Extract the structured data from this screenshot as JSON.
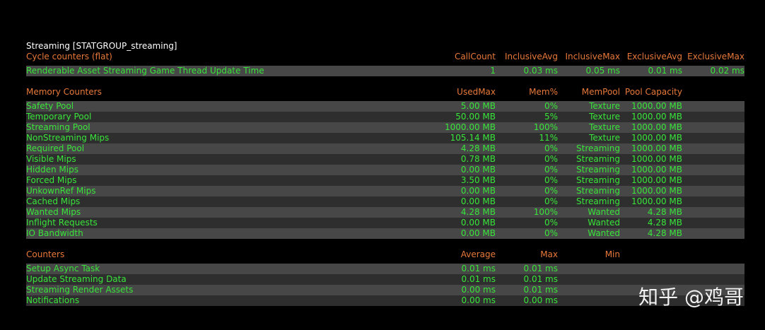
{
  "title": "Streaming [STATGROUP_streaming]",
  "cycle": {
    "header": [
      "Cycle counters (flat)",
      "CallCount",
      "InclusiveAvg",
      "InclusiveMax",
      "ExclusiveAvg",
      "ExclusiveMax"
    ],
    "rows": [
      [
        "Renderable Asset Streaming Game Thread Update Time",
        "1",
        "0.03 ms",
        "0.05 ms",
        "0.01 ms",
        "0.02 ms"
      ]
    ]
  },
  "memory": {
    "header": [
      "Memory Counters",
      "UsedMax",
      "Mem%",
      "MemPool",
      "Pool Capacity"
    ],
    "rows": [
      [
        "Safety Pool",
        "5.00 MB",
        "0%",
        "Texture",
        "1000.00 MB"
      ],
      [
        "Temporary Pool",
        "50.00 MB",
        "5%",
        "Texture",
        "1000.00 MB"
      ],
      [
        "Streaming Pool",
        "1000.00 MB",
        "100%",
        "Texture",
        "1000.00 MB"
      ],
      [
        "NonStreaming Mips",
        "105.14 MB",
        "11%",
        "Texture",
        "1000.00 MB"
      ],
      [
        "Required Pool",
        "4.28 MB",
        "0%",
        "Streaming",
        "1000.00 MB"
      ],
      [
        "Visible Mips",
        "0.78 MB",
        "0%",
        "Streaming",
        "1000.00 MB"
      ],
      [
        "Hidden Mips",
        "0.00 MB",
        "0%",
        "Streaming",
        "1000.00 MB"
      ],
      [
        "Forced Mips",
        "3.50 MB",
        "0%",
        "Streaming",
        "1000.00 MB"
      ],
      [
        "UnkownRef Mips",
        "0.00 MB",
        "0%",
        "Streaming",
        "1000.00 MB"
      ],
      [
        "Cached Mips",
        "0.00 MB",
        "0%",
        "Streaming",
        "1000.00 MB"
      ],
      [
        "Wanted Mips",
        "4.28 MB",
        "100%",
        "Wanted",
        "4.28 MB"
      ],
      [
        "Inflight Requests",
        "0.00 MB",
        "0%",
        "Wanted",
        "4.28 MB"
      ],
      [
        "IO Bandwidth",
        "0.00 MB",
        "0%",
        "Wanted",
        "4.28 MB"
      ]
    ]
  },
  "counters": {
    "header": [
      "Counters",
      "Average",
      "Max",
      "Min"
    ],
    "rows": [
      [
        "Setup Async Task",
        "0.01 ms",
        "0.01 ms",
        ""
      ],
      [
        "Update Streaming Data",
        "0.01 ms",
        "0.01 ms",
        ""
      ],
      [
        "Streaming Render Assets",
        "0.00 ms",
        "0.01 ms",
        ""
      ],
      [
        "Notifications",
        "0.00 ms",
        "0.00 ms",
        ""
      ]
    ]
  },
  "watermark": "知乎 @鸡哥",
  "colors": {
    "background": "#000000",
    "header_text": "#e8793a",
    "data_text": "#39e53a",
    "title_text": "#ffffff",
    "row_dark": "#2e2e2e",
    "row_light": "#474747"
  }
}
